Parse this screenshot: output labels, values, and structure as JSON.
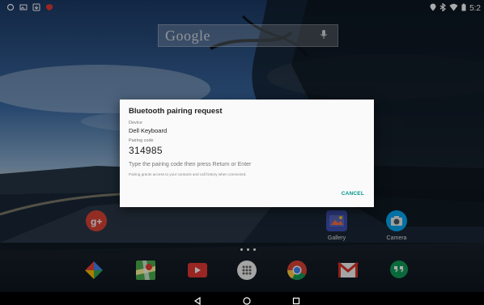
{
  "status_bar": {
    "time": "5:2",
    "left_icons": [
      "notification-icon",
      "image-icon",
      "download-icon",
      "shield-icon"
    ],
    "right_icons": [
      "location-icon",
      "bluetooth-icon",
      "wifi-icon",
      "battery-icon"
    ]
  },
  "search": {
    "logo": "Google",
    "mic_icon": "mic-icon"
  },
  "home_apps": [
    {
      "label": "G+",
      "icon": "google-plus-icon",
      "color": "#db4437"
    },
    {
      "label": "Gallery",
      "icon": "gallery-icon",
      "color": "#3f51b5"
    },
    {
      "label": "Camera",
      "icon": "camera-icon",
      "color": "#03a9f4"
    }
  ],
  "dock": [
    {
      "icon": "pinwheel-icon"
    },
    {
      "icon": "maps-icon"
    },
    {
      "icon": "youtube-icon"
    },
    {
      "icon": "app-drawer-icon"
    },
    {
      "icon": "chrome-icon"
    },
    {
      "icon": "gmail-icon"
    },
    {
      "icon": "hangouts-icon"
    }
  ],
  "navigation": {
    "back_icon": "back-icon",
    "home_icon": "home-icon",
    "recents_icon": "recents-icon"
  },
  "dialog": {
    "title": "Bluetooth pairing request",
    "device_label": "Device",
    "device_name": "Dell Keyboard",
    "code_label": "Pairing code",
    "code": "314985",
    "instruction": "Type the pairing code then press Return or Enter",
    "note": "Pairing grants access to your contacts and call history when connected.",
    "cancel": "CANCEL"
  },
  "colors": {
    "accent": "#009688",
    "dialog_bg": "#fafafa",
    "title_text": "#212121"
  }
}
